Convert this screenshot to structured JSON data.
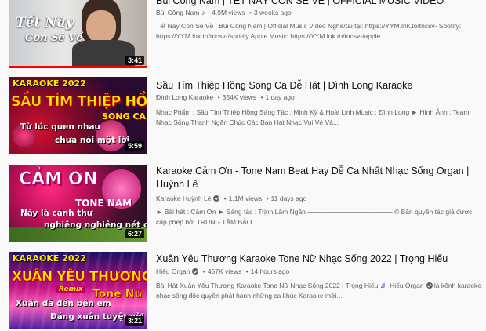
{
  "videos": [
    {
      "title": "Bùi Công Nam | TẾT NÀY CON SẼ VỀ | OFFICIAL MUSIC VIDEO",
      "channel": "Bùi Công Nam",
      "views": "4.9M views",
      "age": "3 weeks ago",
      "desc": "Tết Này Con Sẽ Về | Bùi Công Nam | Official Music Video Nghe/tải tại: https://YYM.lnk.to/tncsv- Spotify: https://YYM.lnk.to/tncsv-/spotify Apple Music: https://YYM.lnk.to/tncsv-/apple...",
      "duration": "3:41",
      "thumb_text_1": "Tết Này",
      "thumb_text_2": "Con Sẽ Về"
    },
    {
      "title": "Sầu Tím Thiệp Hồng Song Ca Dễ Hát | Đình Long Karaoke",
      "channel": "Đình Long Karaoke",
      "views": "354K views",
      "age": "1 day ago",
      "desc": "Nhạc Phẩm : Sầu Tím Thiệp Hồng Sáng Tác : Minh Kỳ & Hoài Linh Music : Đình Long ► Hình Ảnh : Team Nhạc Sống Thanh Ngân Chúc Các Bạn Hát Nhạc Vui Vẻ Và...",
      "duration": "5:59",
      "thumb_text_1": "KARAOKE 2022",
      "thumb_text_2": "SẦU TÍM THIỆP HỒNG",
      "thumb_text_3": "SONG CA",
      "thumb_text_4": "Từ lúc quen nhau",
      "thumb_text_5": "chưa nói một lời"
    },
    {
      "title": "Karaoke Cảm Ơn - Tone Nam Beat Hay Dễ Ca Nhất Nhạc Sống Organ | Huỳnh Lê",
      "channel": "Karaoke Huỳnh Lê",
      "views": "1.1M views",
      "age": "11 days ago",
      "desc": "► Bài hát : Cảm Ơn ► Sáng tác : Trịnh Lâm Ngân ────────────────── © Bản quyền tác giả được cấp phép bởi TRUNG TÂM BẢO...",
      "duration": "6:27",
      "thumb_text_1": "CẢM ƠN",
      "thumb_text_2": "TONE NAM",
      "thumb_text_3": "Này là cánh thư",
      "thumb_text_4": "nghiêng nghiêng nét chữ"
    },
    {
      "title": "Xuân Yêu Thương Karaoke Tone Nữ Nhạc Sống 2022 | Trọng Hiếu",
      "channel": "Hiếu Organ",
      "views": "457K views",
      "age": "14 hours ago",
      "desc_a": "Bài Hát Xuân Yêu Thương Karaoke Tone Nữ Nhạc Sống 2022 | Trọng Hiếu",
      "desc_b": "Hiếu Organ",
      "desc_c": "là kênh karaoke nhạc sống độc quyền phát hành những ca khúc Karaoke mới...",
      "duration": "3:21",
      "thumb_text_1": "KARAOKE 2022",
      "thumb_text_2": "XUÂN YÊU THƯƠNG",
      "thumb_text_3": "Remix",
      "thumb_text_4": "Tone Nữ",
      "thumb_text_5": "Xuân đã đến bên em",
      "thumb_text_6": "Dáng xuân tuyệt vời"
    }
  ],
  "colors": {
    "karaoke_yellow": "#ffe600",
    "karaoke_red": "#e01010",
    "meta_gray": "#606060"
  }
}
